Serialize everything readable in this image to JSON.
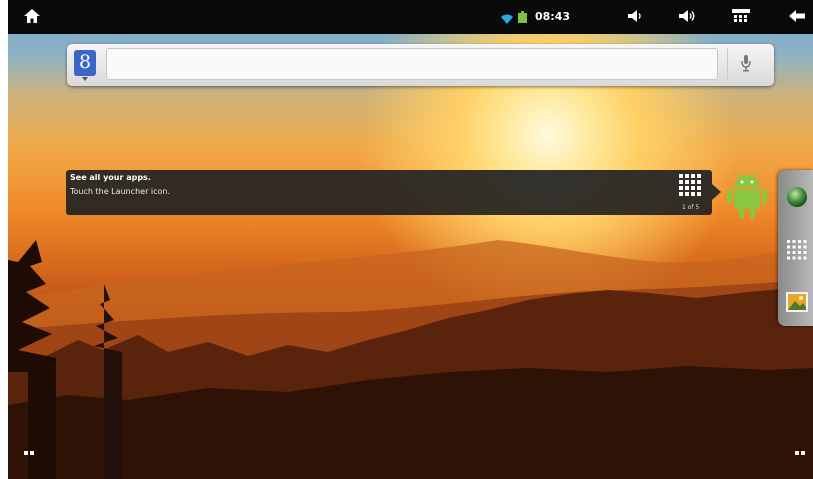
{
  "statusbar": {
    "clock": "08:43",
    "icons": [
      "home-icon",
      "wifi-icon",
      "battery-icon",
      "volume-down-icon",
      "volume-up-icon",
      "menu-icon",
      "back-icon"
    ]
  },
  "search": {
    "value": "",
    "placeholder": "",
    "google_letter": "8",
    "icons": [
      "google-icon",
      "microphone-icon"
    ]
  },
  "hint": {
    "title": "See all your apps.",
    "text": "Touch the Launcher icon.",
    "page": "1 of 5"
  },
  "sidebar": {
    "items": [
      "browser-globe-icon",
      "apps-grid-icon",
      "gallery-icon"
    ]
  },
  "colors": {
    "statusbar": "#0a0a0a",
    "google_blue": "#3b66c6",
    "android_green": "#8ac640",
    "hint_bg": "#232323"
  }
}
